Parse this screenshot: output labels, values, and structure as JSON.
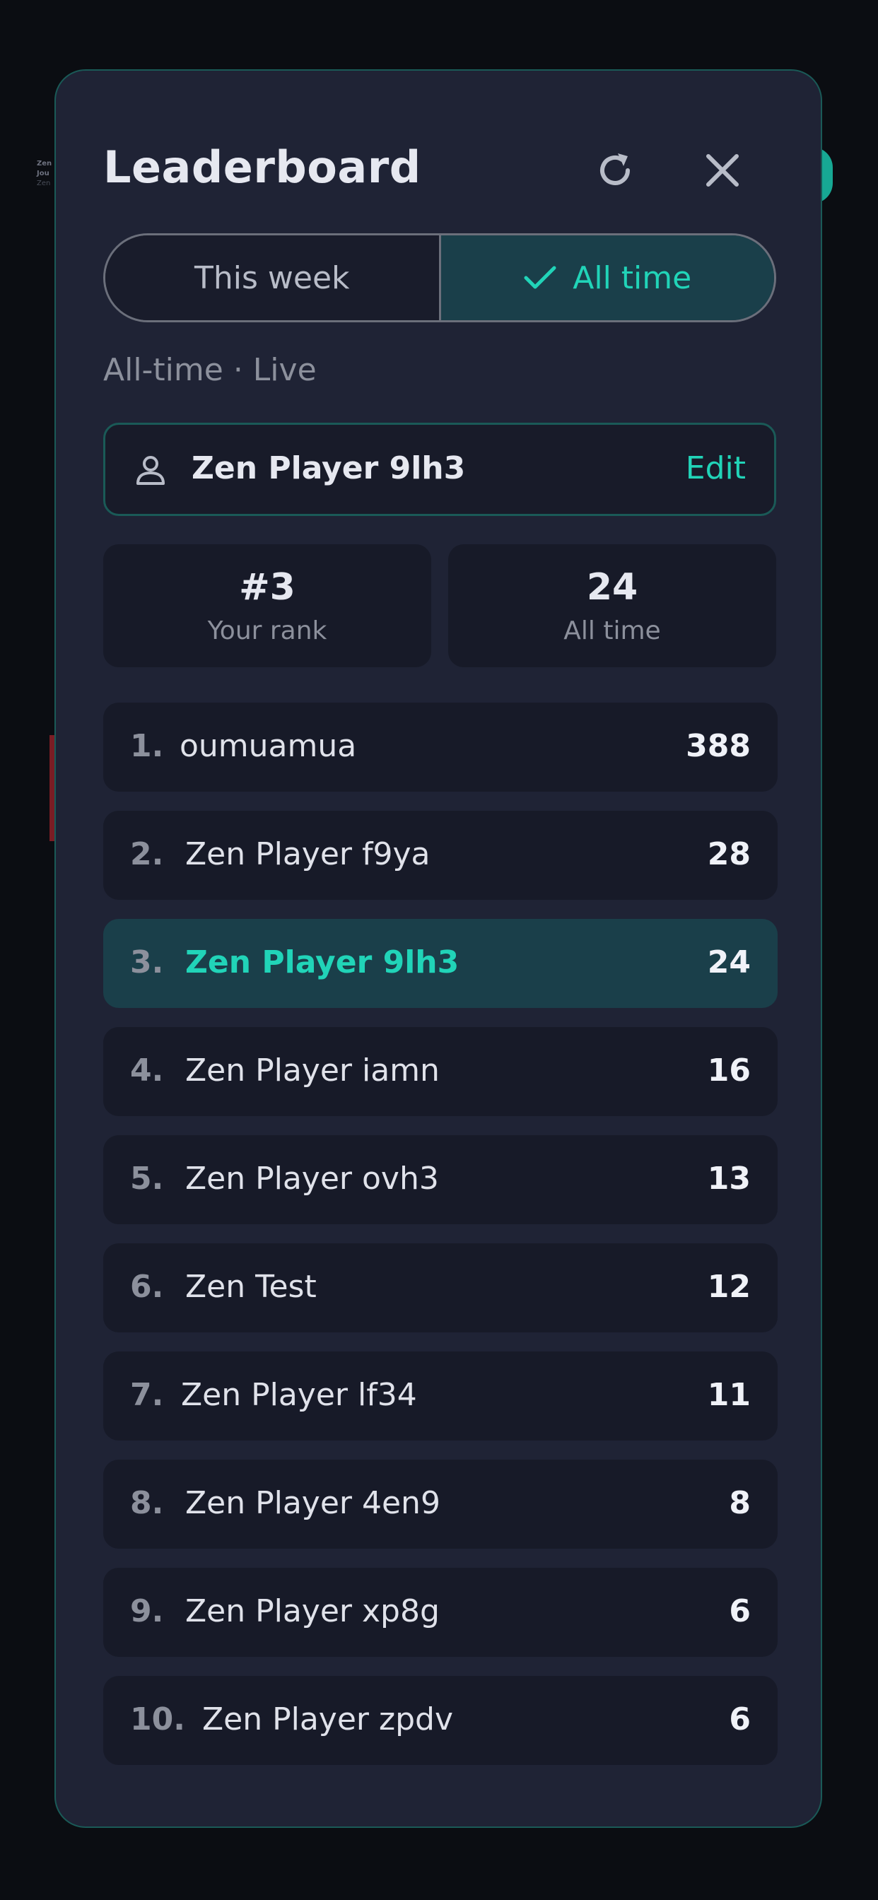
{
  "background": {
    "hint_line1": "Zen",
    "hint_line2": "Jou",
    "hint_line3": "Zen"
  },
  "colors": {
    "accent": "#21d4b8",
    "panel": "#1f2335",
    "highlight_row": "#1a3f4a"
  },
  "header": {
    "title": "Leaderboard",
    "refresh_icon": "refresh-icon",
    "close_icon": "close-icon"
  },
  "segment": {
    "this_week": "This week",
    "all_time": "All time",
    "selected": "All time"
  },
  "subtitle": "All-time · Live",
  "player": {
    "name": "Zen Player 9lh3",
    "edit_label": "Edit"
  },
  "stats": {
    "rank_value": "#3",
    "rank_label": "Your rank",
    "score_value": "24",
    "score_label": "All time"
  },
  "leaderboard": [
    {
      "rank": "1.",
      "name": "oumuamua",
      "score": "388"
    },
    {
      "rank": "2.",
      "name": "Zen Player f9ya",
      "score": "28"
    },
    {
      "rank": "3.",
      "name": "Zen Player 9lh3",
      "score": "24"
    },
    {
      "rank": "4.",
      "name": "Zen Player iamn",
      "score": "16"
    },
    {
      "rank": "5.",
      "name": "Zen Player ovh3",
      "score": "13"
    },
    {
      "rank": "6.",
      "name": "Zen Test",
      "score": "12"
    },
    {
      "rank": "7.",
      "name": "Zen Player lf34",
      "score": "11"
    },
    {
      "rank": "8.",
      "name": "Zen Player 4en9",
      "score": "8"
    },
    {
      "rank": "9.",
      "name": "Zen Player xp8g",
      "score": "6"
    },
    {
      "rank": "10.",
      "name": "Zen Player zpdv",
      "score": "6"
    }
  ]
}
